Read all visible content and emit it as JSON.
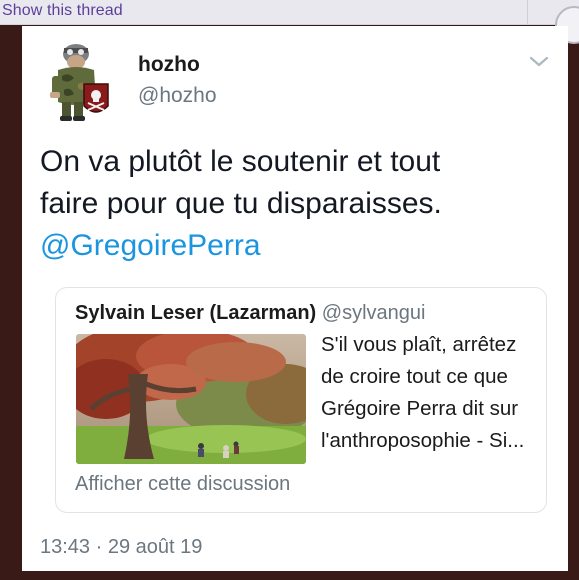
{
  "thread_link": "Show this thread",
  "tweet": {
    "display_name": "hozho",
    "handle": "@hozho",
    "text_lines": [
      "On va plutôt le soutenir et tout",
      "faire pour que tu disparaisses."
    ],
    "mention": "@GregoirePerra",
    "timestamp": "13:43 · 29 août 19",
    "menu_icon": "chevron-down-icon"
  },
  "quoted_tweet": {
    "display_name": "Sylvain Leser (Lazarman)",
    "handle": "@sylvangui",
    "text_lines": [
      "S'il vous plaît, arrêtez",
      "de croire tout ce que",
      "Grégoire Perra dit sur",
      "l'anthroposophie - Si..."
    ],
    "show_discussion": "Afficher cette discussion"
  },
  "colors": {
    "link": "#1b95e0",
    "thread_link": "#5b3f9a",
    "secondary_text": "#6b7780",
    "background": "#3a1a16"
  }
}
